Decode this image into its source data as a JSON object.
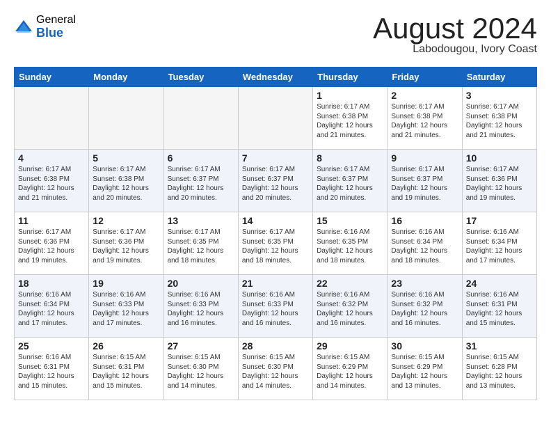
{
  "header": {
    "logo_general": "General",
    "logo_blue": "Blue",
    "month_title": "August 2024",
    "subtitle": "Labodougou, Ivory Coast"
  },
  "weekdays": [
    "Sunday",
    "Monday",
    "Tuesday",
    "Wednesday",
    "Thursday",
    "Friday",
    "Saturday"
  ],
  "weeks": [
    [
      {
        "day": "",
        "info": ""
      },
      {
        "day": "",
        "info": ""
      },
      {
        "day": "",
        "info": ""
      },
      {
        "day": "",
        "info": ""
      },
      {
        "day": "1",
        "info": "Sunrise: 6:17 AM\nSunset: 6:38 PM\nDaylight: 12 hours\nand 21 minutes."
      },
      {
        "day": "2",
        "info": "Sunrise: 6:17 AM\nSunset: 6:38 PM\nDaylight: 12 hours\nand 21 minutes."
      },
      {
        "day": "3",
        "info": "Sunrise: 6:17 AM\nSunset: 6:38 PM\nDaylight: 12 hours\nand 21 minutes."
      }
    ],
    [
      {
        "day": "4",
        "info": "Sunrise: 6:17 AM\nSunset: 6:38 PM\nDaylight: 12 hours\nand 21 minutes."
      },
      {
        "day": "5",
        "info": "Sunrise: 6:17 AM\nSunset: 6:38 PM\nDaylight: 12 hours\nand 20 minutes."
      },
      {
        "day": "6",
        "info": "Sunrise: 6:17 AM\nSunset: 6:37 PM\nDaylight: 12 hours\nand 20 minutes."
      },
      {
        "day": "7",
        "info": "Sunrise: 6:17 AM\nSunset: 6:37 PM\nDaylight: 12 hours\nand 20 minutes."
      },
      {
        "day": "8",
        "info": "Sunrise: 6:17 AM\nSunset: 6:37 PM\nDaylight: 12 hours\nand 20 minutes."
      },
      {
        "day": "9",
        "info": "Sunrise: 6:17 AM\nSunset: 6:37 PM\nDaylight: 12 hours\nand 19 minutes."
      },
      {
        "day": "10",
        "info": "Sunrise: 6:17 AM\nSunset: 6:36 PM\nDaylight: 12 hours\nand 19 minutes."
      }
    ],
    [
      {
        "day": "11",
        "info": "Sunrise: 6:17 AM\nSunset: 6:36 PM\nDaylight: 12 hours\nand 19 minutes."
      },
      {
        "day": "12",
        "info": "Sunrise: 6:17 AM\nSunset: 6:36 PM\nDaylight: 12 hours\nand 19 minutes."
      },
      {
        "day": "13",
        "info": "Sunrise: 6:17 AM\nSunset: 6:35 PM\nDaylight: 12 hours\nand 18 minutes."
      },
      {
        "day": "14",
        "info": "Sunrise: 6:17 AM\nSunset: 6:35 PM\nDaylight: 12 hours\nand 18 minutes."
      },
      {
        "day": "15",
        "info": "Sunrise: 6:16 AM\nSunset: 6:35 PM\nDaylight: 12 hours\nand 18 minutes."
      },
      {
        "day": "16",
        "info": "Sunrise: 6:16 AM\nSunset: 6:34 PM\nDaylight: 12 hours\nand 18 minutes."
      },
      {
        "day": "17",
        "info": "Sunrise: 6:16 AM\nSunset: 6:34 PM\nDaylight: 12 hours\nand 17 minutes."
      }
    ],
    [
      {
        "day": "18",
        "info": "Sunrise: 6:16 AM\nSunset: 6:34 PM\nDaylight: 12 hours\nand 17 minutes."
      },
      {
        "day": "19",
        "info": "Sunrise: 6:16 AM\nSunset: 6:33 PM\nDaylight: 12 hours\nand 17 minutes."
      },
      {
        "day": "20",
        "info": "Sunrise: 6:16 AM\nSunset: 6:33 PM\nDaylight: 12 hours\nand 16 minutes."
      },
      {
        "day": "21",
        "info": "Sunrise: 6:16 AM\nSunset: 6:33 PM\nDaylight: 12 hours\nand 16 minutes."
      },
      {
        "day": "22",
        "info": "Sunrise: 6:16 AM\nSunset: 6:32 PM\nDaylight: 12 hours\nand 16 minutes."
      },
      {
        "day": "23",
        "info": "Sunrise: 6:16 AM\nSunset: 6:32 PM\nDaylight: 12 hours\nand 16 minutes."
      },
      {
        "day": "24",
        "info": "Sunrise: 6:16 AM\nSunset: 6:31 PM\nDaylight: 12 hours\nand 15 minutes."
      }
    ],
    [
      {
        "day": "25",
        "info": "Sunrise: 6:16 AM\nSunset: 6:31 PM\nDaylight: 12 hours\nand 15 minutes."
      },
      {
        "day": "26",
        "info": "Sunrise: 6:15 AM\nSunset: 6:31 PM\nDaylight: 12 hours\nand 15 minutes."
      },
      {
        "day": "27",
        "info": "Sunrise: 6:15 AM\nSunset: 6:30 PM\nDaylight: 12 hours\nand 14 minutes."
      },
      {
        "day": "28",
        "info": "Sunrise: 6:15 AM\nSunset: 6:30 PM\nDaylight: 12 hours\nand 14 minutes."
      },
      {
        "day": "29",
        "info": "Sunrise: 6:15 AM\nSunset: 6:29 PM\nDaylight: 12 hours\nand 14 minutes."
      },
      {
        "day": "30",
        "info": "Sunrise: 6:15 AM\nSunset: 6:29 PM\nDaylight: 12 hours\nand 13 minutes."
      },
      {
        "day": "31",
        "info": "Sunrise: 6:15 AM\nSunset: 6:28 PM\nDaylight: 12 hours\nand 13 minutes."
      }
    ]
  ]
}
